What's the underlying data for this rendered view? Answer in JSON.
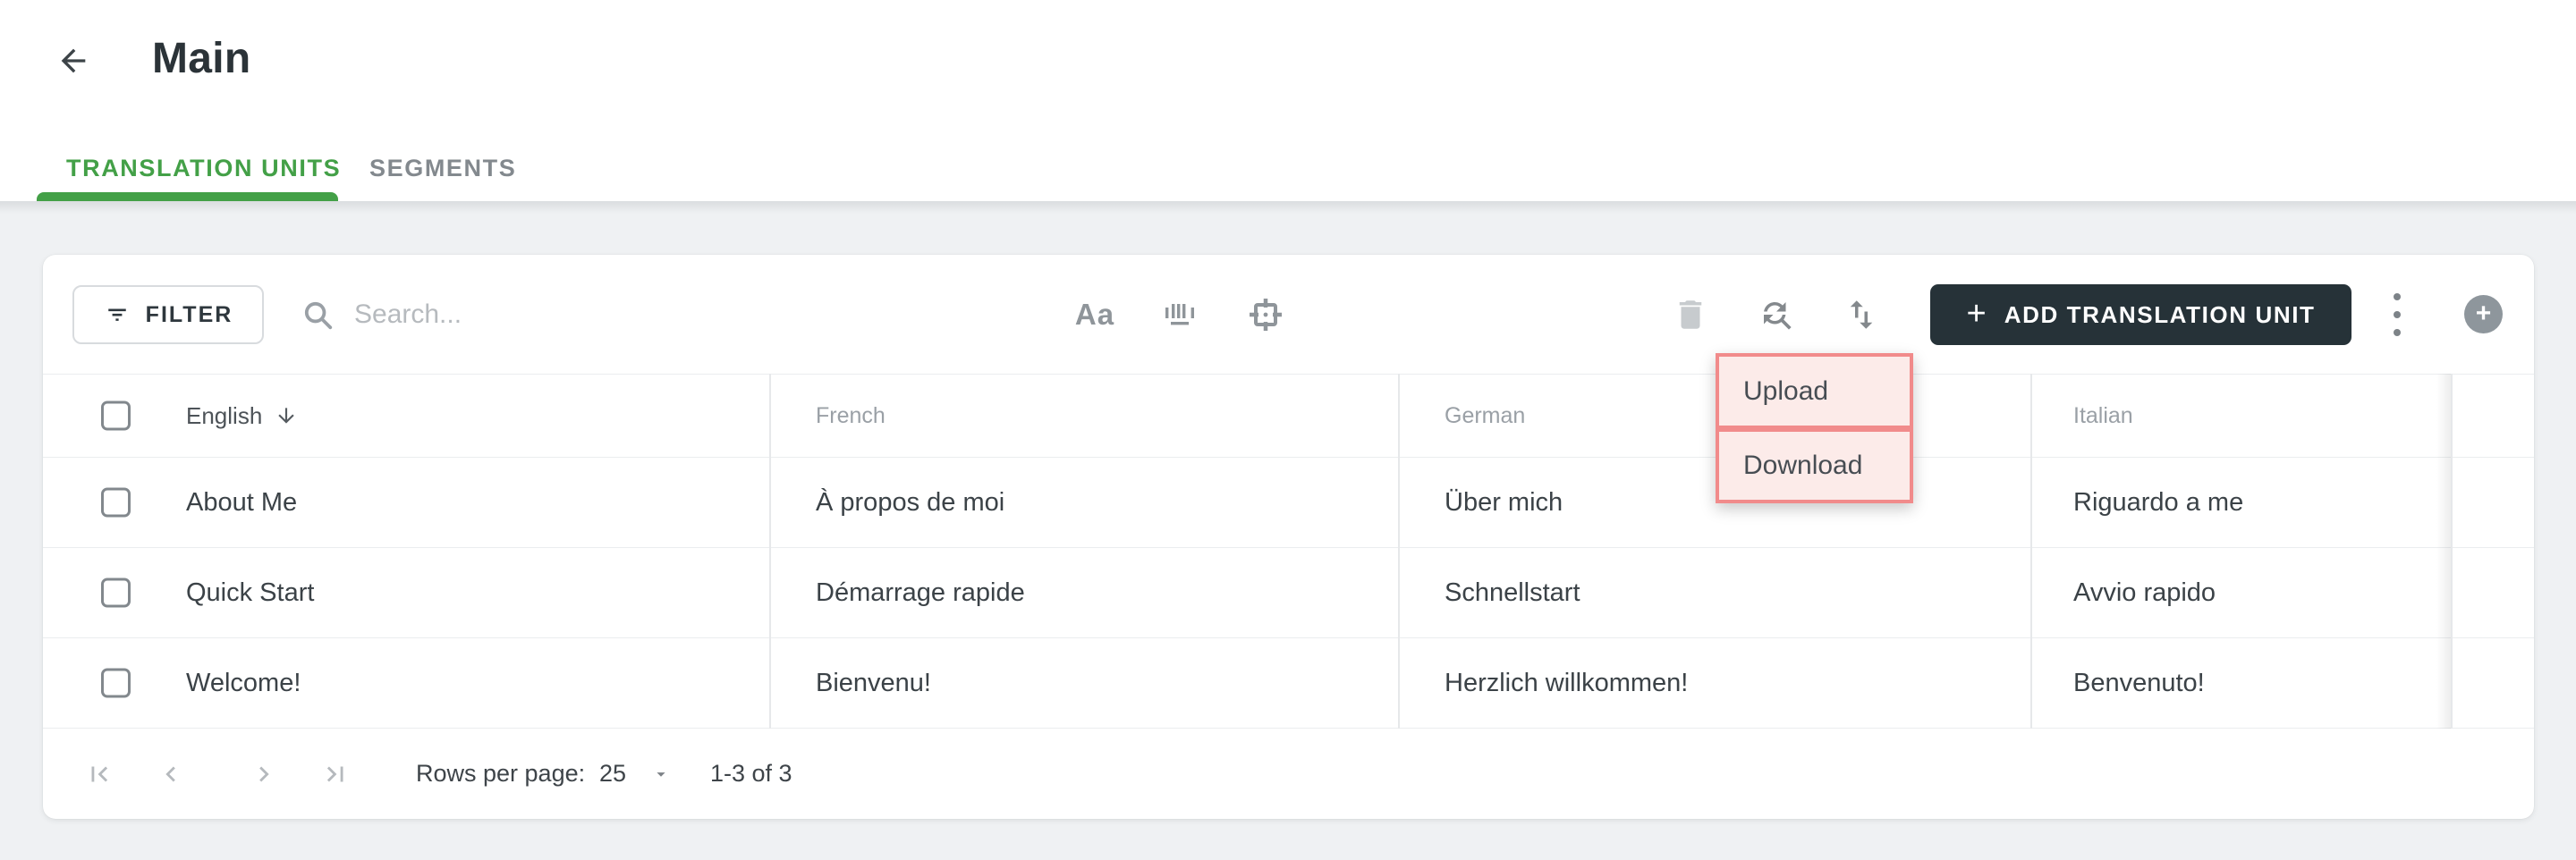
{
  "header": {
    "title": "Main"
  },
  "tabs": [
    {
      "label": "TRANSLATION UNITS",
      "active": true
    },
    {
      "label": "SEGMENTS",
      "active": false
    }
  ],
  "toolbar": {
    "filter_label": "FILTER",
    "search_placeholder": "Search...",
    "case_icon_glyph": "Aa",
    "add_label": "ADD TRANSLATION UNIT",
    "add_plus_glyph": "+",
    "fab_plus_glyph": "+"
  },
  "menu": {
    "items": [
      "Upload",
      "Download"
    ]
  },
  "table": {
    "columns": [
      "English",
      "French",
      "German",
      "Italian"
    ],
    "sorted_column": "English",
    "sort_direction": "asc",
    "rows": [
      [
        "About Me",
        "À propos de moi",
        "Über mich",
        "Riguardo a me"
      ],
      [
        "Quick Start",
        "Démarrage rapide",
        "Schnellstart",
        "Avvio rapido"
      ],
      [
        "Welcome!",
        "Bienvenu!",
        "Herzlich willkommen!",
        "Benvenuto!"
      ]
    ]
  },
  "pagination": {
    "rows_per_page_label": "Rows per page:",
    "rows_per_page_value": "25",
    "range_label": "1-3 of 3"
  },
  "icons": {
    "back": "arrow-left",
    "filter": "filter-list",
    "search": "magnifier",
    "case": "Aa-text",
    "whole_word": "barcode-bars",
    "frame": "selection-frame-target",
    "delete": "trash-filled",
    "find_replace": "circular-arrows-replace",
    "import_export": "up-down-arrows",
    "kebab": "vertical-three-dots",
    "pagination": [
      "first-page",
      "chevron-left",
      "chevron-right",
      "last-page"
    ]
  },
  "colors": {
    "accent_green": "#43a047",
    "dark_button": "#263238",
    "page_bg": "#eff1f3",
    "highlight_border": "#f18b8b",
    "highlight_fill": "#fcebe9"
  }
}
